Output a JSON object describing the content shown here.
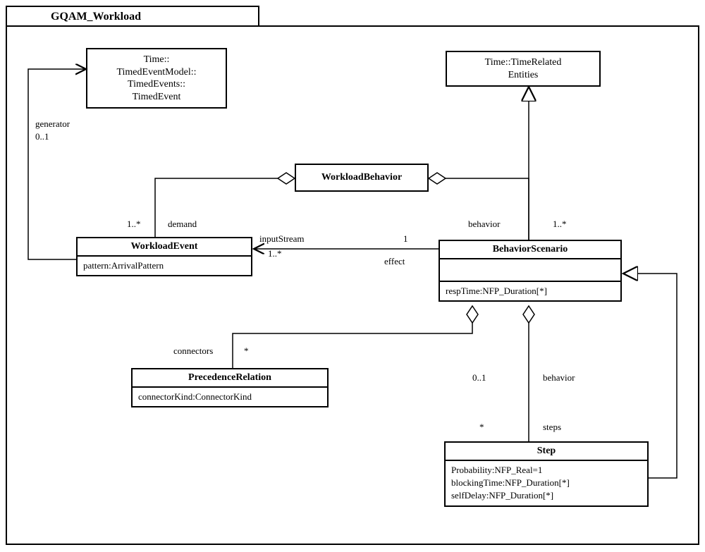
{
  "package": {
    "title": "GQAM_Workload"
  },
  "classes": {
    "timedEvent": {
      "line1": "Time::",
      "line2": "TimedEventModel::",
      "line3": "TimedEvents::",
      "line4": "TimedEvent"
    },
    "timeRelatedEntities": {
      "line1": "Time::TimeRelated",
      "line2": "Entities"
    },
    "workloadBehavior": {
      "name": "WorkloadBehavior"
    },
    "workloadEvent": {
      "name": "WorkloadEvent",
      "attr1": "pattern:ArrivalPattern"
    },
    "behaviorScenario": {
      "name": "BehaviorScenario",
      "attr1": "respTime:NFP_Duration[*]"
    },
    "precedenceRelation": {
      "name": "PrecedenceRelation",
      "attr1": "connectorKind:ConnectorKind"
    },
    "step": {
      "name": "Step",
      "attr1": "Probability:NFP_Real=1",
      "attr2": "blockingTime:NFP_Duration[*]",
      "attr3": "selfDelay:NFP_Duration[*]"
    }
  },
  "labels": {
    "generator": "generator",
    "generatorMult": "0..1",
    "demandMult": "1..*",
    "demand": "demand",
    "inputStream": "inputStream",
    "inputStreamMult": "1..*",
    "effectMult": "1",
    "effect": "effect",
    "behaviorTop": "behavior",
    "behaviorTopMult": "1..*",
    "connectors": "connectors",
    "connectorsMult": "*",
    "behaviorBS": "behavior",
    "behaviorBSMult": "0..1",
    "steps": "steps",
    "stepsMult": "*"
  },
  "chart_data": {
    "type": "uml-class-diagram",
    "package": "GQAM_Workload",
    "classes": [
      {
        "name": "Time::TimedEventModel::TimedEvents::TimedEvent",
        "attrs": []
      },
      {
        "name": "Time::TimeRelatedEntities",
        "attrs": []
      },
      {
        "name": "WorkloadBehavior",
        "attrs": []
      },
      {
        "name": "WorkloadEvent",
        "attrs": [
          "pattern:ArrivalPattern"
        ]
      },
      {
        "name": "BehaviorScenario",
        "attrs": [
          "respTime:NFP_Duration[*]"
        ]
      },
      {
        "name": "PrecedenceRelation",
        "attrs": [
          "connectorKind:ConnectorKind"
        ]
      },
      {
        "name": "Step",
        "attrs": [
          "Probability:NFP_Real=1",
          "blockingTime:NFP_Duration[*]",
          "selfDelay:NFP_Duration[*]"
        ]
      }
    ],
    "relations": [
      {
        "from": "WorkloadEvent",
        "to": "TimedEvent",
        "type": "directed-association",
        "role": "generator",
        "mult": "0..1"
      },
      {
        "from": "WorkloadBehavior",
        "to": "WorkloadEvent",
        "type": "aggregation",
        "role": "demand",
        "mult": "1..*"
      },
      {
        "from": "WorkloadBehavior",
        "to": "BehaviorScenario",
        "type": "aggregation",
        "role": "behavior",
        "mult": "1..*"
      },
      {
        "from": "BehaviorScenario",
        "to": "WorkloadEvent",
        "type": "directed-association",
        "roleTarget": "inputStream",
        "multTarget": "1..*",
        "roleSource": "effect",
        "multSource": "1"
      },
      {
        "from": "BehaviorScenario",
        "to": "TimeRelatedEntities",
        "type": "generalization"
      },
      {
        "from": "BehaviorScenario",
        "to": "PrecedenceRelation",
        "type": "aggregation",
        "role": "connectors",
        "mult": "*"
      },
      {
        "from": "BehaviorScenario",
        "to": "Step",
        "type": "aggregation",
        "roleTarget": "steps",
        "multTarget": "*",
        "roleSource": "behavior",
        "multSource": "0..1"
      },
      {
        "from": "Step",
        "to": "BehaviorScenario",
        "type": "generalization"
      }
    ]
  }
}
